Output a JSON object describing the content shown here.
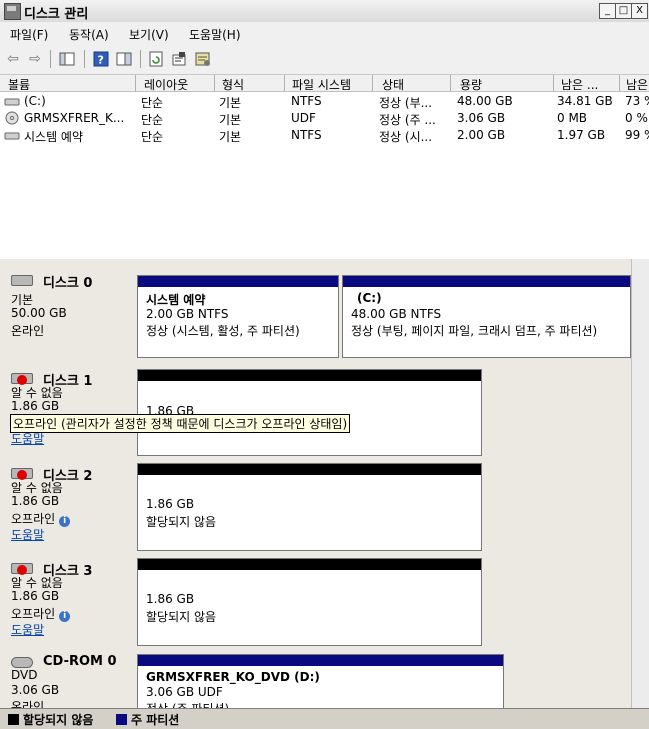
{
  "window": {
    "title": "디스크 관리",
    "minimize": "_",
    "maximize": "□",
    "close": "X"
  },
  "menu": [
    "파일(F)",
    "동작(A)",
    "보기(V)",
    "도움말(H)"
  ],
  "volume_list": {
    "columns": [
      "볼륨",
      "레이아웃",
      "형식",
      "파일 시스템",
      "상태",
      "용량",
      "남은 ...",
      "남은"
    ],
    "rows": [
      [
        "(C:)",
        "단순",
        "기본",
        "NTFS",
        "정상 (부...",
        "48.00 GB",
        "34.81 GB",
        "73 %"
      ],
      [
        "GRMSXFRER_K...",
        "단순",
        "기본",
        "UDF",
        "정상 (주 ...",
        "3.06 GB",
        "0 MB",
        "0 %"
      ],
      [
        "시스템 예약",
        "단순",
        "기본",
        "NTFS",
        "정상 (시...",
        "2.00 GB",
        "1.97 GB",
        "99 %"
      ]
    ]
  },
  "disks": [
    {
      "name": "디스크 0",
      "type": "기본",
      "size": "50.00 GB",
      "status": "온라인",
      "partitions": [
        {
          "title": "시스템 예약",
          "line1": "2.00 GB NTFS",
          "line2": "정상 (시스템, 활성, 주 파티션)"
        },
        {
          "title": "(C:)",
          "line1": "48.00 GB NTFS",
          "line2": "정상 (부팅, 페이지 파일, 크래시 덤프, 주 파티션)"
        }
      ]
    },
    {
      "name": "디스크 1",
      "type": "알 수 없음",
      "size": "1.86 GB",
      "status": "오프라인",
      "help": "도움말",
      "partition": {
        "line1": "1.86 GB",
        "line2": ""
      }
    },
    {
      "name": "디스크 2",
      "type": "알 수 없음",
      "size": "1.86 GB",
      "status": "오프라인",
      "help": "도움말",
      "partition": {
        "line1": "1.86 GB",
        "line2": "할당되지 않음"
      }
    },
    {
      "name": "디스크 3",
      "type": "알 수 없음",
      "size": "1.86 GB",
      "status": "오프라인",
      "help": "도움말",
      "partition": {
        "line1": "1.86 GB",
        "line2": "할당되지 않음"
      }
    },
    {
      "name": "CD-ROM 0",
      "type": "DVD",
      "size": "3.06 GB",
      "status": "온라인",
      "partition": {
        "title": "GRMSXFRER_KO_DVD  (D:)",
        "line1": "3.06 GB UDF",
        "line2": "정상 (주 파티션)"
      }
    }
  ],
  "tooltip": "오프라인 (관리자가 설정한 정책 때문에 디스크가 오프라인 상태임)",
  "legend": {
    "unallocated": "할당되지 않음",
    "primary": "주 파티션"
  },
  "colors": {
    "primary_bar": "#0a0a80",
    "unallocated_bar": "#000000",
    "legend_unallocated": "#000000",
    "legend_primary": "#0a0a80"
  }
}
